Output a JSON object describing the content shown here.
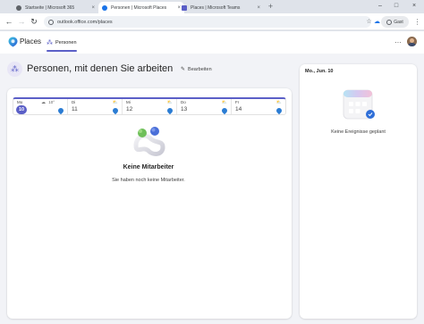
{
  "browser": {
    "tabs": [
      {
        "title": "Startseite | Microsoft 365",
        "favicon_color": "#5f6368",
        "active": false
      },
      {
        "title": "Personen | Microsoft Places",
        "favicon_color": "#1a73e8",
        "active": true
      },
      {
        "title": "Places | Microsoft Teams",
        "favicon_color": "#5b5fc7",
        "active": false
      }
    ],
    "new_tab_label": "+",
    "close_label": "×",
    "url": "outlook.office.com/places",
    "guest_label": "Gast",
    "window_controls": {
      "minimize": "–",
      "maximize": "□",
      "close": "×"
    },
    "nav": {
      "back": "←",
      "forward": "→",
      "reload": "↻"
    }
  },
  "app": {
    "brand_name": "Places",
    "nav_tab": "Personen",
    "more_label": "···",
    "accent_color": "#5b5fc7"
  },
  "page": {
    "title": "Personen, mit denen Sie arbeiten",
    "edit_label": "Bearbeiten"
  },
  "week": [
    {
      "day": "Mo",
      "date": "10",
      "weather": "10°",
      "today": true
    },
    {
      "day": "Di",
      "date": "11",
      "weather": "",
      "today": false
    },
    {
      "day": "Mi",
      "date": "12",
      "weather": "",
      "today": false
    },
    {
      "day": "Do",
      "date": "13",
      "weather": "",
      "today": false
    },
    {
      "day": "Fr",
      "date": "14",
      "weather": "",
      "today": false
    }
  ],
  "empty_state": {
    "title": "Keine Mitarbeiter",
    "subtitle": "Sie haben noch keine Mitarbeiter."
  },
  "side_panel": {
    "date": "Mo., Jun. 10",
    "empty_text": "Keine Ereignisse geplant"
  }
}
